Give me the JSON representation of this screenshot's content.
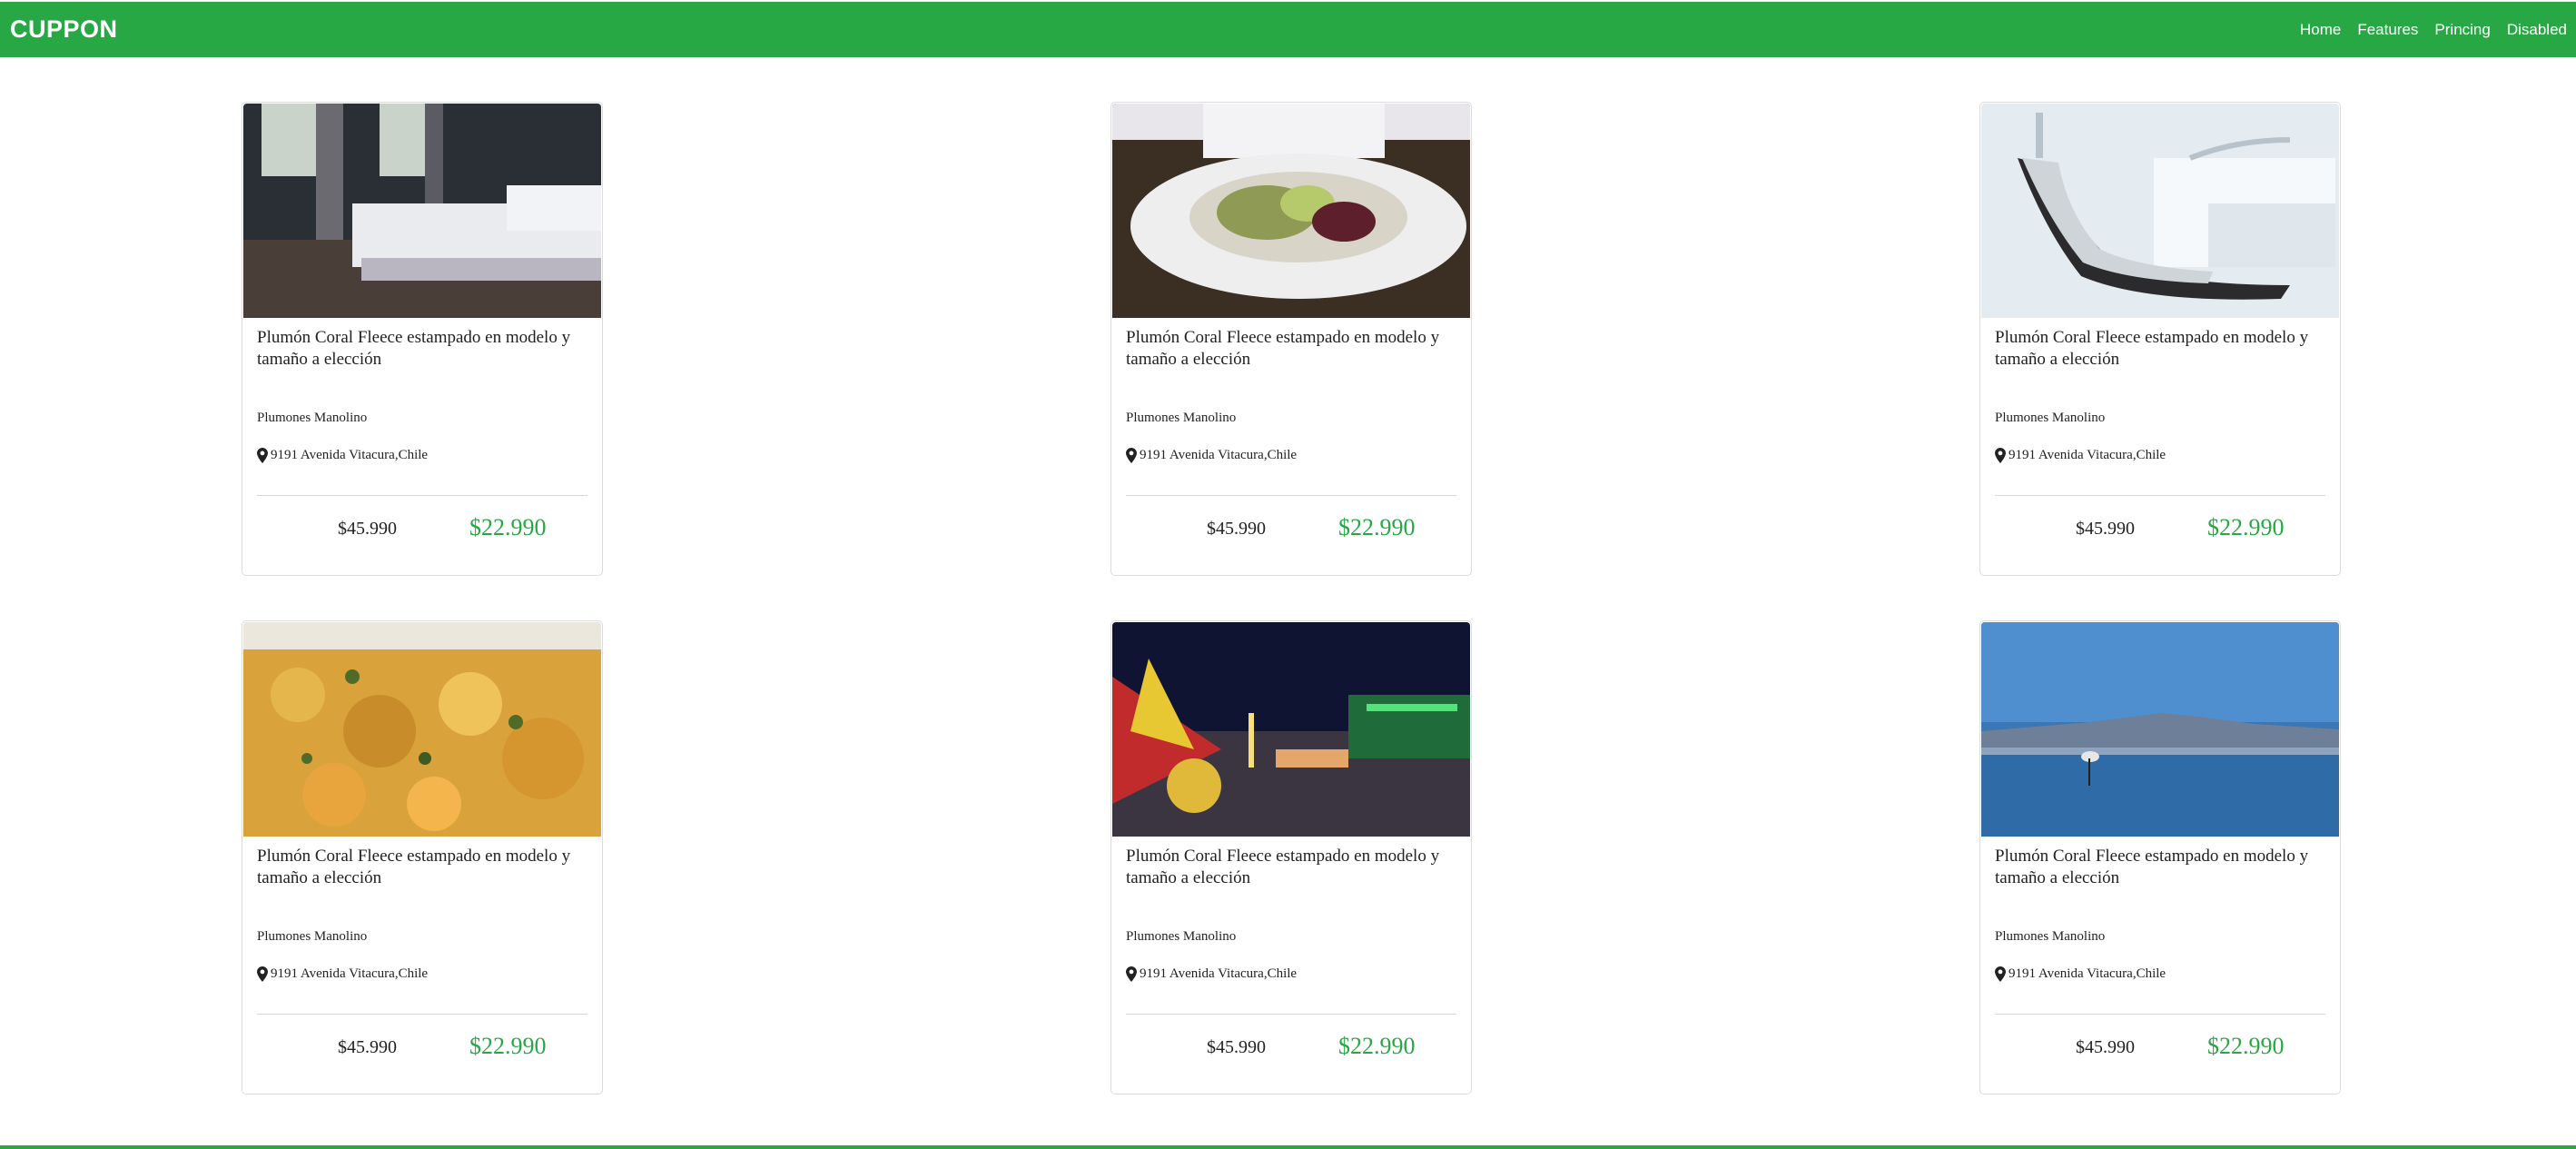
{
  "header": {
    "brand": "CUPPON",
    "nav": [
      "Home",
      "Features",
      "Princing",
      "Disabled"
    ],
    "color": "#28a745"
  },
  "cards": [
    {
      "image": "bedroom-photo",
      "title": "Plumón Coral Fleece estampado en modelo y tamaño a elección",
      "vendor": "Plumones Manolino",
      "location": "9191 Avenida Vitacura,Chile",
      "old_price": "$45.990",
      "new_price": "$22.990"
    },
    {
      "image": "salad-photo",
      "title": "Plumón Coral Fleece estampado en modelo y tamaño a elección",
      "vendor": "Plumones Manolino",
      "location": "9191 Avenida Vitacura,Chile",
      "old_price": "$45.990",
      "new_price": "$22.990"
    },
    {
      "image": "dental-chair-photo",
      "title": "Plumón Coral Fleece estampado en modelo y tamaño a elección",
      "vendor": "Plumones Manolino",
      "location": "9191 Avenida Vitacura,Chile",
      "old_price": "$45.990",
      "new_price": "$22.990"
    },
    {
      "image": "stew-photo",
      "title": "Plumón Coral Fleece estampado en modelo y tamaño a elección",
      "vendor": "Plumones Manolino",
      "location": "9191 Avenida Vitacura,Chile",
      "old_price": "$45.990",
      "new_price": "$22.990"
    },
    {
      "image": "fairground-photo",
      "title": "Plumón Coral Fleece estampado en modelo y tamaño a elección",
      "vendor": "Plumones Manolino",
      "location": "9191 Avenida Vitacura,Chile",
      "old_price": "$45.990",
      "new_price": "$22.990"
    },
    {
      "image": "flamingo-lake-photo",
      "title": "Plumón Coral Fleece estampado en modelo y tamaño a elección",
      "vendor": "Plumones Manolino",
      "location": "9191 Avenida Vitacura,Chile",
      "old_price": "$45.990",
      "new_price": "$22.990"
    }
  ],
  "colors": {
    "price_green": "#28a745",
    "text": "#222222"
  },
  "icons": {
    "location": "map-marker-icon"
  }
}
